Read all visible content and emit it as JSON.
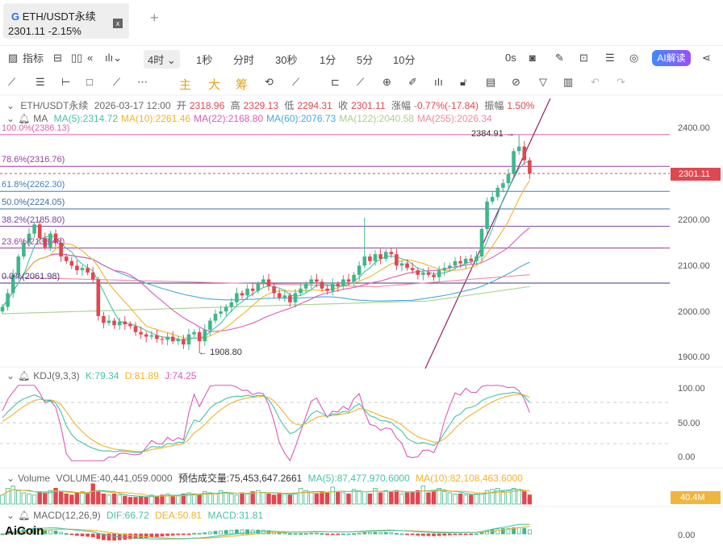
{
  "tab": {
    "title": "ETH/USDT永续",
    "price": "2301.11",
    "change": "-2.15%",
    "close": "x",
    "add": "+"
  },
  "toolbar": {
    "indicators": "指标",
    "interval": "4时",
    "intervals": [
      "1秒",
      "分时",
      "30秒",
      "1分",
      "5分",
      "10分"
    ],
    "countdown": "0s",
    "ai": "AI解读"
  },
  "drawbar": {
    "main": "主",
    "big": "大",
    "chip": "筹"
  },
  "ohlc": {
    "symbol": "ETH/USDT永续",
    "time": "2026-03-17 12:00",
    "open_l": "开",
    "open": "2318.96",
    "high_l": "高",
    "high": "2329.13",
    "low_l": "低",
    "low": "2294.31",
    "close_l": "收",
    "close": "2301.11",
    "chg_l": "涨幅",
    "chg": "-0.77%(-17.84)",
    "amp_l": "振幅",
    "amp": "1.50%"
  },
  "ma": {
    "label": "MA",
    "items": [
      {
        "t": "MA(5):2314.72",
        "c": "#45c3a6"
      },
      {
        "t": "MA(10):2261.46",
        "c": "#f0b429"
      },
      {
        "t": "MA(22):2168.80",
        "c": "#d95bb8"
      },
      {
        "t": "MA(60):2076.73",
        "c": "#4aa8d8"
      },
      {
        "t": "MA(122):2040.58",
        "c": "#a8d08d"
      },
      {
        "t": "MA(255):2026.34",
        "c": "#f08aa0"
      }
    ]
  },
  "fib": [
    {
      "t": "100.0%(2386.13)",
      "v": 2386.13,
      "c": "#d95bb8"
    },
    {
      "t": "78.6%(2316.76)",
      "v": 2316.76,
      "c": "#9b3fa0"
    },
    {
      "t": "61.8%(2262.30)",
      "v": 2262.3,
      "c": "#3f7fbf"
    },
    {
      "t": "50.0%(2224.05)",
      "v": 2224.05,
      "c": "#3f6fa0"
    },
    {
      "t": "38.2%(2185.80)",
      "v": 2185.8,
      "c": "#7a3fa0"
    },
    {
      "t": "23.6%(2138.48)",
      "v": 2138.48,
      "c": "#9b3fa0"
    },
    {
      "t": "0.0%(2061.98)",
      "v": 2061.98,
      "c": "#4a2f80"
    }
  ],
  "price_axis": [
    "2400.00",
    "2300.00",
    "2200.00",
    "2100.00",
    "2000.00",
    "1900.00"
  ],
  "current_price": "2301.11",
  "high_mark": "2384.91",
  "low_mark": "1908.80",
  "kdj": {
    "label": "KDJ(9,3,3)",
    "k": "K:79.34",
    "d": "D:81.89",
    "j": "J:74.25",
    "axis": [
      "100.00",
      "50.00",
      "0.00"
    ]
  },
  "volume": {
    "label": "Volume",
    "vol": "VOLUME:40,441,059.0000",
    "est": "预估成交量:75,453,647.2661",
    "ma5": "MA(5):87,477,970.6000",
    "ma10": "MA(10):82,108,463.6000",
    "tag": "40.4M"
  },
  "macd": {
    "label": "MACD(12,26,9)",
    "dif": "DIF:66.72",
    "dea": "DEA:50.81",
    "macd": "MACD:31.81",
    "axis": "0.00"
  },
  "brand": "AiCoin",
  "colors": {
    "up": "#3fb68b",
    "down": "#e0474f"
  },
  "chart_data": {
    "type": "candlestick",
    "ylim": [
      1900,
      2400
    ],
    "closes": [
      2010,
      2040,
      2080,
      2120,
      2150,
      2170,
      2190,
      2160,
      2140,
      2170,
      2150,
      2120,
      2110,
      2100,
      2090,
      2095,
      2085,
      2070,
      1990,
      1975,
      1980,
      1970,
      1978,
      1972,
      1968,
      1955,
      1950,
      1945,
      1948,
      1940,
      1938,
      1945,
      1935,
      1940,
      1928,
      1950,
      1955,
      1935,
      1960,
      1980,
      1995,
      2000,
      2010,
      2020,
      2040,
      2035,
      2050,
      2045,
      2060,
      2070,
      2055,
      2040,
      2030,
      2035,
      2020,
      2040,
      2050,
      2060,
      2070,
      2065,
      2050,
      2045,
      2060,
      2055,
      2070,
      2065,
      2080,
      2100,
      2120,
      2110,
      2125,
      2115,
      2130,
      2125,
      2100,
      2105,
      2095,
      2090,
      2080,
      2085,
      2080,
      2075,
      2090,
      2095,
      2100,
      2110,
      2105,
      2115,
      2110,
      2120,
      2180,
      2240,
      2250,
      2270,
      2280,
      2300,
      2350,
      2360,
      2330,
      2301.11
    ],
    "volumes_m": [
      40,
      70,
      80,
      60,
      50,
      45,
      40,
      55,
      50,
      60,
      70,
      55,
      45,
      40,
      50,
      55,
      45,
      90,
      60,
      45,
      40,
      45,
      40,
      35,
      30,
      30,
      35,
      30,
      40,
      35,
      40,
      45,
      35,
      40,
      45,
      50,
      45,
      40,
      55,
      50,
      45,
      60,
      50,
      45,
      40,
      50,
      45,
      55,
      60,
      50,
      45,
      40,
      50,
      45,
      40,
      50,
      70,
      60,
      50,
      45,
      55,
      50,
      75,
      55,
      50,
      45,
      65,
      60,
      55,
      45,
      70,
      50,
      60,
      55,
      60,
      45,
      50,
      55,
      60,
      80,
      50,
      60,
      70,
      55,
      50,
      45,
      45,
      40,
      40,
      45,
      50,
      60,
      65,
      70,
      55,
      60,
      70,
      65,
      55,
      40.4
    ]
  }
}
